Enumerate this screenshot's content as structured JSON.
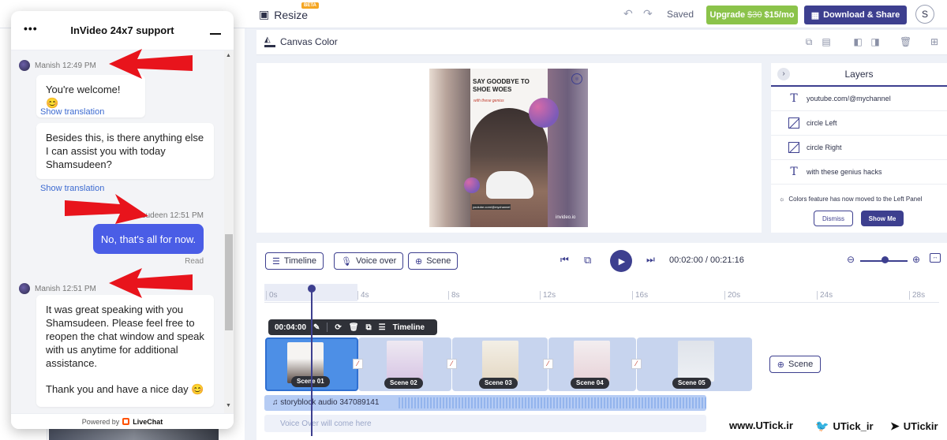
{
  "topbar": {
    "title": "Resize",
    "beta": "BETA",
    "saved": "Saved",
    "upgrade_label": "Upgrade",
    "upgrade_old_price": "$30",
    "upgrade_new_price": "$15/mo",
    "download_label": "Download & Share",
    "avatar_letter": "S"
  },
  "canvasbar": {
    "canvas_color_label": "Canvas Color"
  },
  "poster": {
    "headline": "SAY GOODBYE TO SHOE WOES",
    "subline": "with these genius",
    "handle": "youtube.com/@mychannel",
    "brand": "invideo.io"
  },
  "layers": {
    "title": "Layers",
    "items": [
      {
        "label": "youtube.com/@mychannel",
        "icon": "text-icon"
      },
      {
        "label": "circle Left",
        "icon": "shape-icon"
      },
      {
        "label": "circle Right",
        "icon": "shape-icon"
      },
      {
        "label": "with these genius hacks",
        "icon": "text-icon"
      }
    ],
    "notice": "Colors feature has now moved to the Left Panel",
    "dismiss_label": "Dismiss",
    "show_me_label": "Show Me"
  },
  "timeline": {
    "timeline_label": "Timeline",
    "voiceover_label": "Voice over",
    "scene_label": "Scene",
    "time_current": "00:02:00",
    "time_separator": "/",
    "time_total": "00:21:16",
    "ruler_ticks": [
      "0s",
      "4s",
      "8s",
      "12s",
      "16s",
      "20s",
      "24s",
      "28s"
    ],
    "scene_toolbar_time": "00:04:00",
    "scene_toolbar_timeline": "Timeline",
    "scenes": [
      "Scene 01",
      "Scene 02",
      "Scene 03",
      "Scene 04",
      "Scene 05"
    ],
    "add_scene_label": "Scene",
    "audio_label": "storyblock audio 347089141",
    "voice_placeholder": "Voice Over will come here"
  },
  "watermark": {
    "site": "www.UTick.ir",
    "twitter": "UTick_ir",
    "telegram": "UTickir"
  },
  "chat": {
    "title": "InVideo 24x7 support",
    "messages": {
      "m1_meta": "Manish 12:49 PM",
      "m1_text": "You're welcome! 😊",
      "show_translation_1": "Show translation",
      "m2_text": "Besides this, is there anything else I can assist you with today Shamsudeen?",
      "show_translation_2": "Show translation",
      "user_meta": "Shamsudeen 12:51 PM",
      "user_text": "No, that's all for now.",
      "read": "Read",
      "m3_meta": "Manish 12:51 PM",
      "m3_text_1": "It was great speaking with you Shamsudeen. Please feel free to reopen the chat window and speak with us anytime for additional assistance.",
      "m3_text_2": "Thank you and have a nice day 😊"
    },
    "powered_prefix": "Powered by",
    "powered_brand": "LiveChat"
  },
  "colors": {
    "brand": "#3d3f8f",
    "upgrade": "#8bc34a",
    "user_bubble": "#4a5de6",
    "annotation_arrow": "#e8141c"
  }
}
